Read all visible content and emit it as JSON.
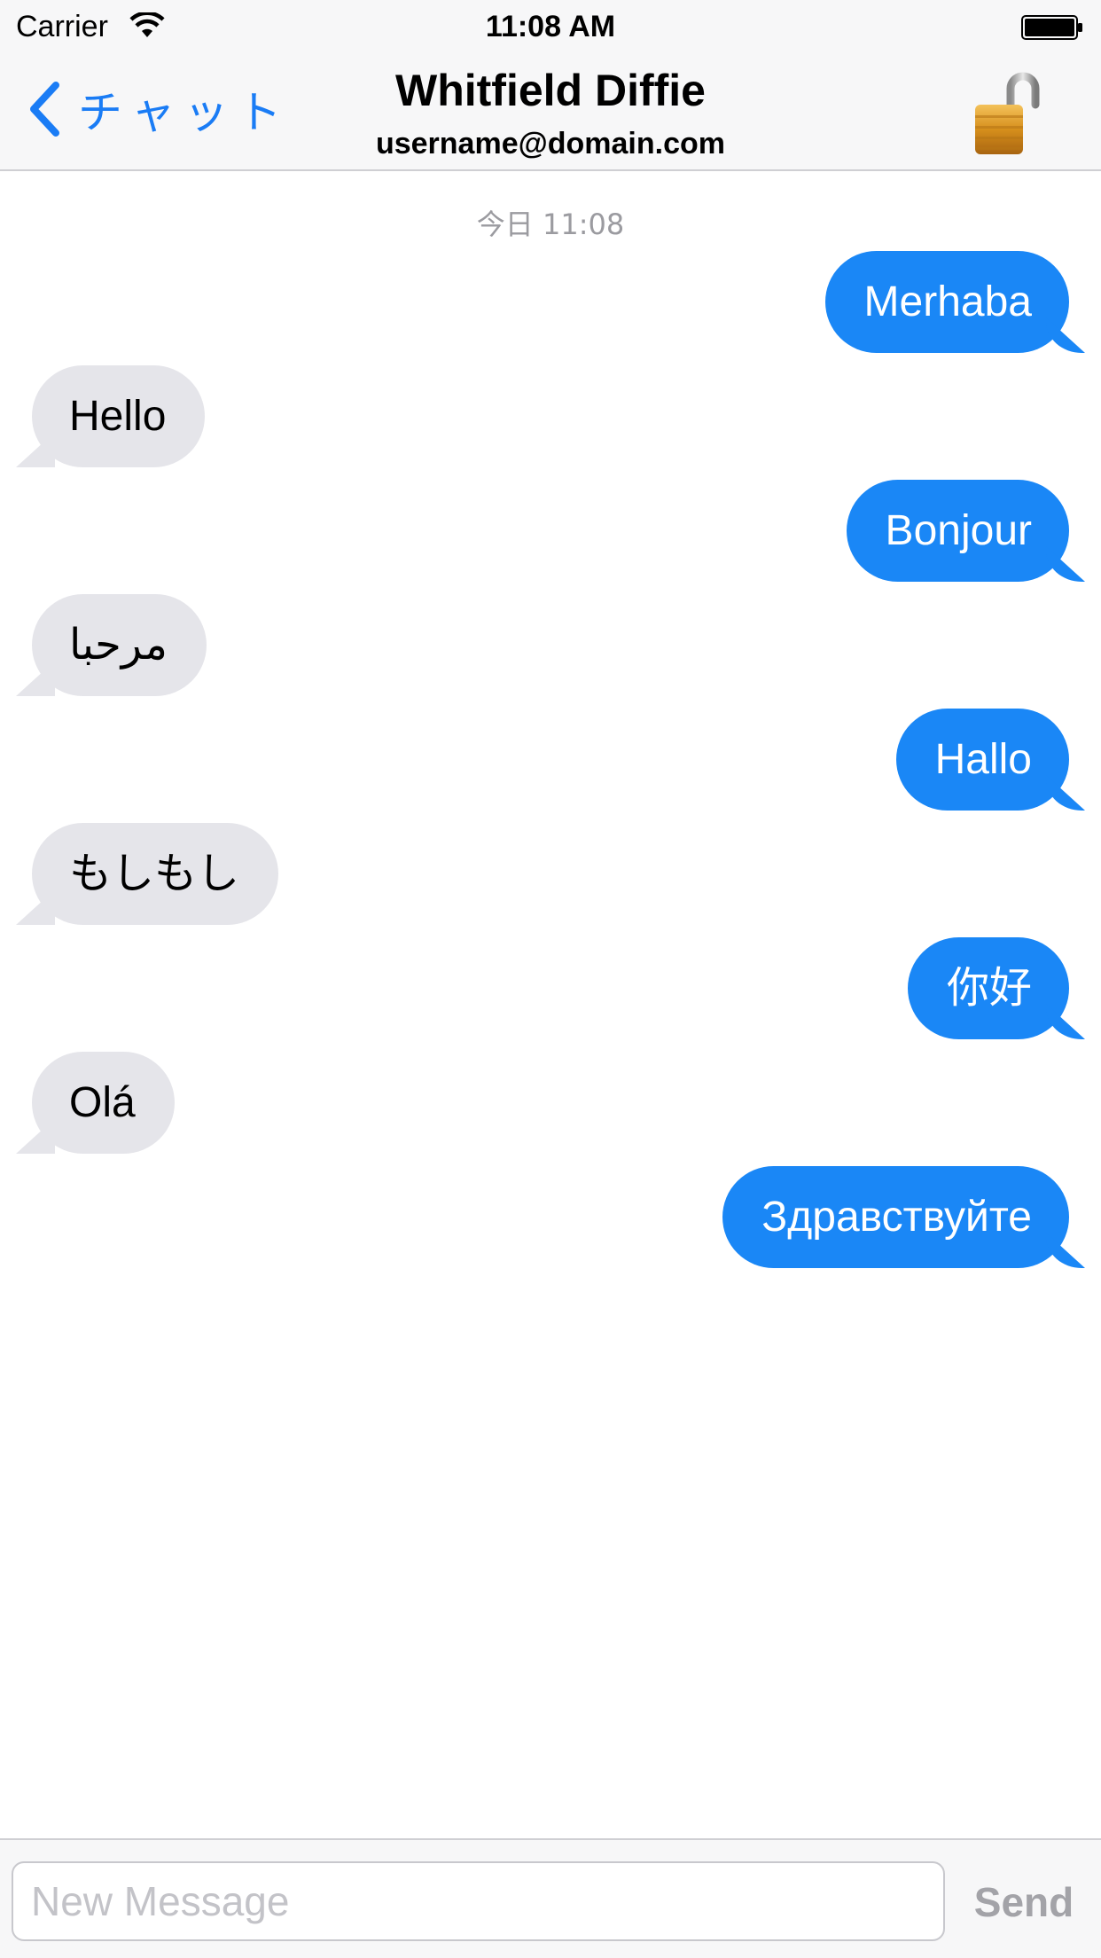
{
  "status_bar": {
    "carrier": "Carrier",
    "time": "11:08 AM",
    "wifi_icon": "wifi-icon",
    "battery_icon": "battery-icon"
  },
  "nav": {
    "back_label": "チャット",
    "back_icon": "chevron-left-icon",
    "title": "Whitfield Diffie",
    "subtitle": "username@domain.com",
    "lock_icon": "padlock-open-icon"
  },
  "thread": {
    "timestamp": "今日 11:08",
    "messages": [
      {
        "direction": "outgoing",
        "text": "Merhaba"
      },
      {
        "direction": "incoming",
        "text": "Hello"
      },
      {
        "direction": "outgoing",
        "text": "Bonjour"
      },
      {
        "direction": "incoming",
        "text": "مرحبا"
      },
      {
        "direction": "outgoing",
        "text": "Hallo"
      },
      {
        "direction": "incoming",
        "text": "もしもし"
      },
      {
        "direction": "outgoing",
        "text": "你好"
      },
      {
        "direction": "incoming",
        "text": "Olá"
      },
      {
        "direction": "outgoing",
        "text": "Здравствуйте"
      }
    ]
  },
  "composer": {
    "placeholder": "New Message",
    "value": "",
    "send_label": "Send"
  },
  "colors": {
    "accent": "#1a7cf5",
    "outgoing_bubble": "#1a87f6",
    "incoming_bubble": "#e5e5ea",
    "bar_background": "#f7f7f8"
  }
}
